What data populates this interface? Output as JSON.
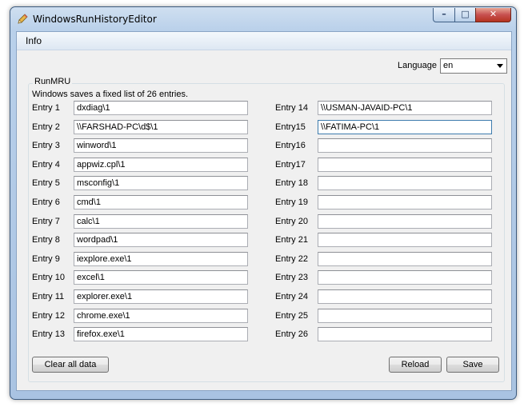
{
  "window": {
    "title": "WindowsRunHistoryEditor",
    "controls": {
      "minimize": "–",
      "maximize": "□",
      "close": "✕"
    }
  },
  "menu": {
    "info": "Info"
  },
  "language": {
    "label": "Language",
    "selected": "en"
  },
  "group": {
    "title": "RunMRU",
    "description": "Windows saves a fixed list of 26 entries."
  },
  "entries_left": [
    {
      "label": "Entry 1",
      "value": "dxdiag\\1"
    },
    {
      "label": "Entry 2",
      "value": "\\\\FARSHAD-PC\\d$\\1"
    },
    {
      "label": "Entry 3",
      "value": "winword\\1"
    },
    {
      "label": "Entry 4",
      "value": "appwiz.cpl\\1"
    },
    {
      "label": "Entry 5",
      "value": "msconfig\\1"
    },
    {
      "label": "Entry 6",
      "value": "cmd\\1"
    },
    {
      "label": "Entry 7",
      "value": "calc\\1"
    },
    {
      "label": "Entry 8",
      "value": "wordpad\\1"
    },
    {
      "label": "Entry 9",
      "value": "iexplore.exe\\1"
    },
    {
      "label": "Entry 10",
      "value": "excel\\1"
    },
    {
      "label": "Entry 11",
      "value": "explorer.exe\\1"
    },
    {
      "label": "Entry 12",
      "value": "chrome.exe\\1"
    },
    {
      "label": "Entry 13",
      "value": "firefox.exe\\1"
    }
  ],
  "entries_right": [
    {
      "label": "Entry 14",
      "value": "\\\\USMAN-JAVAID-PC\\1"
    },
    {
      "label": "Entry15",
      "value": "\\\\FATIMA-PC\\1"
    },
    {
      "label": "Entry16",
      "value": ""
    },
    {
      "label": "Entry17",
      "value": ""
    },
    {
      "label": "Entry 18",
      "value": ""
    },
    {
      "label": "Entry 19",
      "value": ""
    },
    {
      "label": "Entry 20",
      "value": ""
    },
    {
      "label": "Entry 21",
      "value": ""
    },
    {
      "label": "Entry 22",
      "value": ""
    },
    {
      "label": "Entry 23",
      "value": ""
    },
    {
      "label": "Entry 24",
      "value": ""
    },
    {
      "label": "Entry 25",
      "value": ""
    },
    {
      "label": "Entry 26",
      "value": ""
    }
  ],
  "buttons": {
    "clear": "Clear all data",
    "reload": "Reload",
    "save": "Save"
  },
  "icons": {
    "app": "pencil-icon"
  },
  "colors": {
    "accent": "#3d7bad",
    "close": "#c75050"
  }
}
